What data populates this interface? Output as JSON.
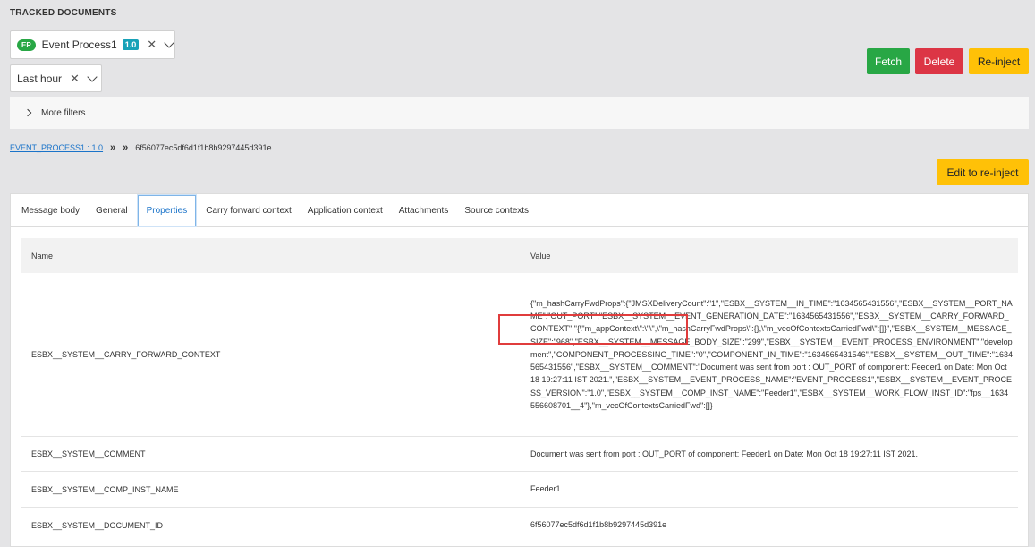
{
  "header": {
    "title": "TRACKED DOCUMENTS"
  },
  "filters": {
    "process": {
      "badge": "EP",
      "name": "Event Process1",
      "version": "1.0",
      "clear_icon": "close-icon",
      "dropdown_icon": "chevron-down-icon"
    },
    "time": {
      "value": "Last hour",
      "clear_icon": "close-icon",
      "dropdown_icon": "chevron-down-icon"
    },
    "more_filters_label": "More filters"
  },
  "actions": {
    "fetch": "Fetch",
    "delete": "Delete",
    "reinject": "Re-inject",
    "edit_reinject": "Edit to re-inject"
  },
  "breadcrumb": {
    "link": "EVENT_PROCESS1 : 1.0",
    "separator": "»",
    "doc_id": "6f56077ec5df6d1f1b8b9297445d391e"
  },
  "tabs": [
    "Message body",
    "General",
    "Properties",
    "Carry forward context",
    "Application context",
    "Attachments",
    "Source contexts"
  ],
  "active_tab": "Properties",
  "table": {
    "headers": {
      "name": "Name",
      "value": "Value"
    },
    "rows": [
      {
        "name": "ESBX__SYSTEM__CARRY_FORWARD_CONTEXT",
        "value": "{\"m_hashCarryFwdProps\":{\"JMSXDeliveryCount\":\"1\",\"ESBX__SYSTEM__IN_TIME\":\"1634565431556\",\"ESBX__SYSTEM__PORT_NAME\":\"OUT_PORT\",\"ESBX__SYSTEM__EVENT_GENERATION_DATE\":\"1634565431556\",\"ESBX__SYSTEM__CARRY_FORWARD_CONTEXT\":\"{\\\"m_appContext\\\":\\\"\\\",\\\"m_hashCarryFwdProps\\\":{},\\\"m_vecOfContextsCarriedFwd\\\":[]}\",\"ESBX__SYSTEM__MESSAGE_SIZE\":\"968\",\"ESBX__SYSTEM__MESSAGE_BODY_SIZE\":\"299\",\"ESBX__SYSTEM__EVENT_PROCESS_ENVIRONMENT\":\"development\",\"COMPONENT_PROCESSING_TIME\":\"0\",\"COMPONENT_IN_TIME\":\"1634565431546\",\"ESBX__SYSTEM__OUT_TIME\":\"1634565431556\",\"ESBX__SYSTEM__COMMENT\":\"Document was sent from port : OUT_PORT of component: Feeder1 on Date: Mon Oct 18 19:27:11 IST 2021.\",\"ESBX__SYSTEM__EVENT_PROCESS_NAME\":\"EVENT_PROCESS1\",\"ESBX__SYSTEM__EVENT_PROCESS_VERSION\":\"1.0\",\"ESBX__SYSTEM__COMP_INST_NAME\":\"Feeder1\",\"ESBX__SYSTEM__WORK_FLOW_INST_ID\":\"fps__1634556608701__4\"},\"m_vecOfContextsCarriedFwd\":[]}"
      },
      {
        "name": "ESBX__SYSTEM__COMMENT",
        "value": "Document was sent from port : OUT_PORT of component: Feeder1 on Date: Mon Oct 18 19:27:11 IST 2021."
      },
      {
        "name": "ESBX__SYSTEM__COMP_INST_NAME",
        "value": "Feeder1"
      },
      {
        "name": "ESBX__SYSTEM__DOCUMENT_ID",
        "value": "6f56077ec5df6d1f1b8b9297445d391e"
      }
    ]
  },
  "colors": {
    "success": "#28a745",
    "danger": "#dc3545",
    "warning": "#ffc107",
    "link": "#1a73c9",
    "highlight": "#e03c3c"
  }
}
